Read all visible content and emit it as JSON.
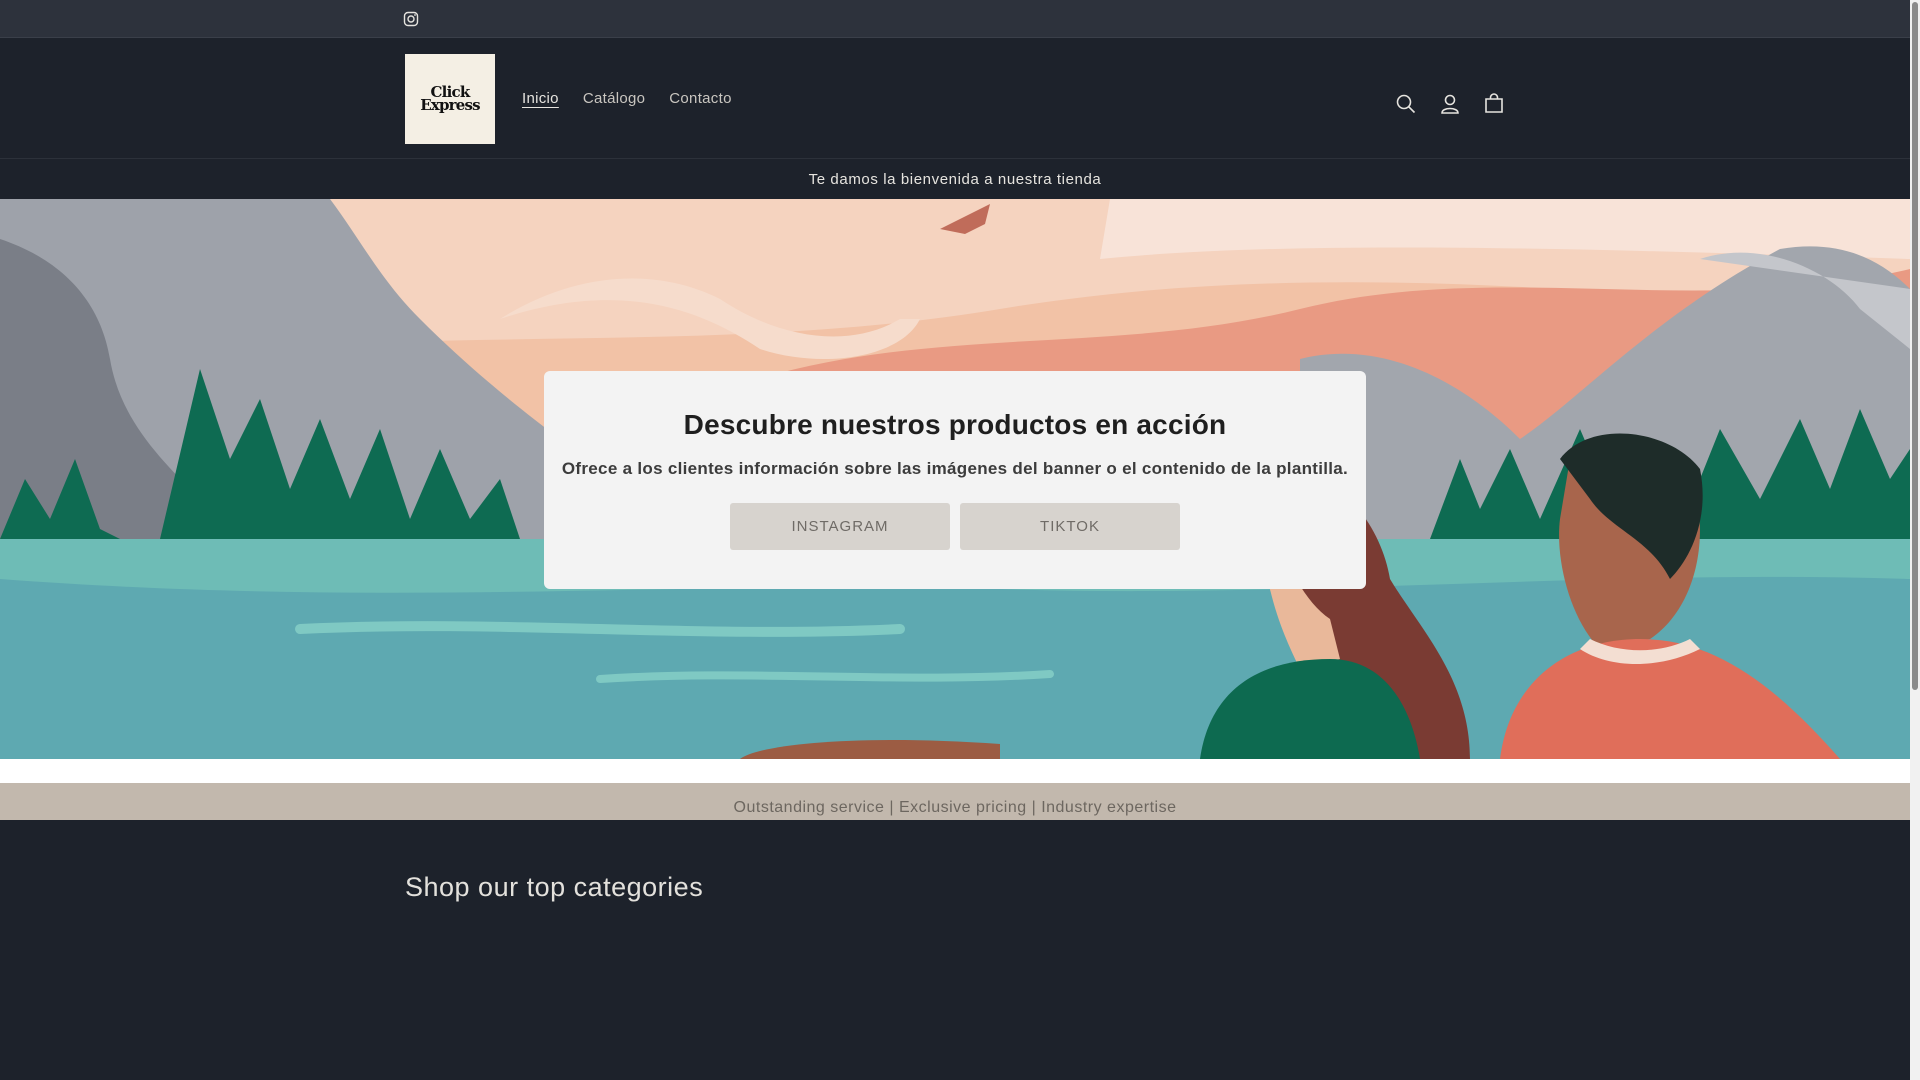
{
  "top_bar": {
    "social_icon": "instagram-icon"
  },
  "header": {
    "logo_text_line1": "Click",
    "logo_text_line2": "Express",
    "nav": [
      {
        "label": "Inicio",
        "active": true
      },
      {
        "label": "Catálogo",
        "active": false
      },
      {
        "label": "Contacto",
        "active": false
      }
    ],
    "icons": [
      "search-icon",
      "account-icon",
      "cart-icon"
    ]
  },
  "announcement": {
    "text": "Te damos la bienvenida a nuestra tienda"
  },
  "banner": {
    "heading": "Descubre nuestros productos en acción",
    "text": "Ofrece a los clientes información sobre las imágenes del banner o el contenido de la plantilla.",
    "buttons": [
      {
        "label": "INSTAGRAM"
      },
      {
        "label": "TIKTOK"
      }
    ]
  },
  "tagline": {
    "text": "Outstanding service | Exclusive pricing | Industry expertise"
  },
  "categories": {
    "heading": "Shop our top categories"
  },
  "colors": {
    "background": "#1d222b",
    "util_bar": "#2d323c",
    "tagline_bg": "#c2b8ad",
    "banner_box": "#f3f3f3",
    "button_bg": "#d7d3ce"
  }
}
